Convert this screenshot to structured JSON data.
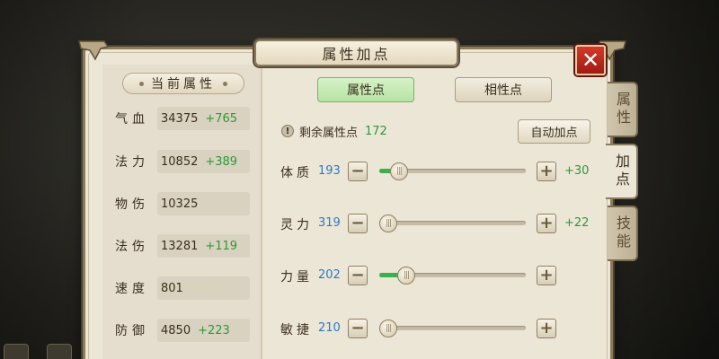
{
  "title": "属性加点",
  "close_label": "✕",
  "left_panel": {
    "header": "当前属性",
    "stats": [
      {
        "label": "气血",
        "value": "34375",
        "bonus": "+765"
      },
      {
        "label": "法力",
        "value": "10852",
        "bonus": "+389"
      },
      {
        "label": "物伤",
        "value": "10325",
        "bonus": ""
      },
      {
        "label": "法伤",
        "value": "13281",
        "bonus": "+119"
      },
      {
        "label": "速度",
        "value": "801",
        "bonus": ""
      },
      {
        "label": "防御",
        "value": "4850",
        "bonus": "+223"
      }
    ]
  },
  "top_tabs": [
    {
      "label": "属性点",
      "active": true
    },
    {
      "label": "相性点",
      "active": false
    }
  ],
  "remaining": {
    "icon": "!",
    "label": "剩余属性点",
    "value": "172"
  },
  "auto_button": "自动加点",
  "attributes": [
    {
      "label": "体质",
      "value": "193",
      "bonus": "+30",
      "level": 0.08
    },
    {
      "label": "灵力",
      "value": "319",
      "bonus": "+22",
      "level": 0.0
    },
    {
      "label": "力量",
      "value": "202",
      "bonus": "",
      "level": 0.13
    },
    {
      "label": "敏捷",
      "value": "210",
      "bonus": "",
      "level": 0.0
    }
  ],
  "side_tabs": [
    {
      "label": "属性",
      "active": false
    },
    {
      "label": "加点",
      "active": true
    },
    {
      "label": "技能",
      "active": false
    }
  ],
  "colors": {
    "bonus_green": "#2a9a33",
    "value_blue": "#2e78c4",
    "close_red": "#c0291c",
    "panel_parchment": "#ece6d7"
  },
  "icons": {
    "close": "close-icon",
    "minus": "minus-icon",
    "plus": "plus-icon",
    "alert": "exclamation-icon"
  }
}
